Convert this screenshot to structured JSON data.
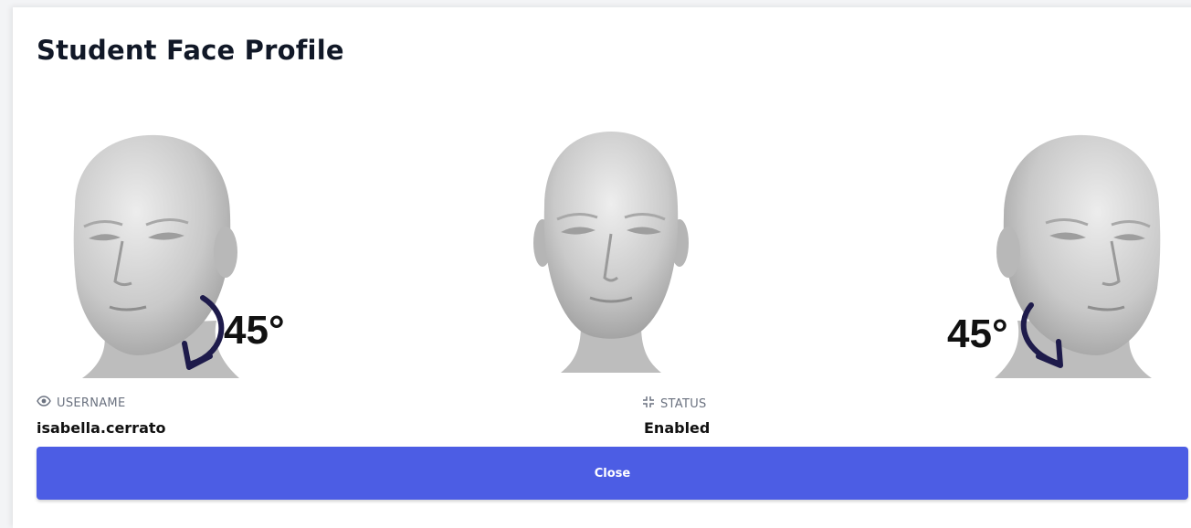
{
  "modal": {
    "title": "Student Face Profile"
  },
  "faces": {
    "left": {
      "angle_label": "45°"
    },
    "center": {},
    "right": {
      "angle_label": "45°"
    }
  },
  "info": {
    "username": {
      "label": "USERNAME",
      "value": "isabella.cerrato",
      "icon": "eye-icon"
    },
    "status": {
      "label": "STATUS",
      "value": "Enabled",
      "icon": "compress-icon"
    }
  },
  "actions": {
    "close_label": "Close"
  },
  "colors": {
    "primary": "#4c5de4",
    "arrow": "#1e1b4b"
  }
}
